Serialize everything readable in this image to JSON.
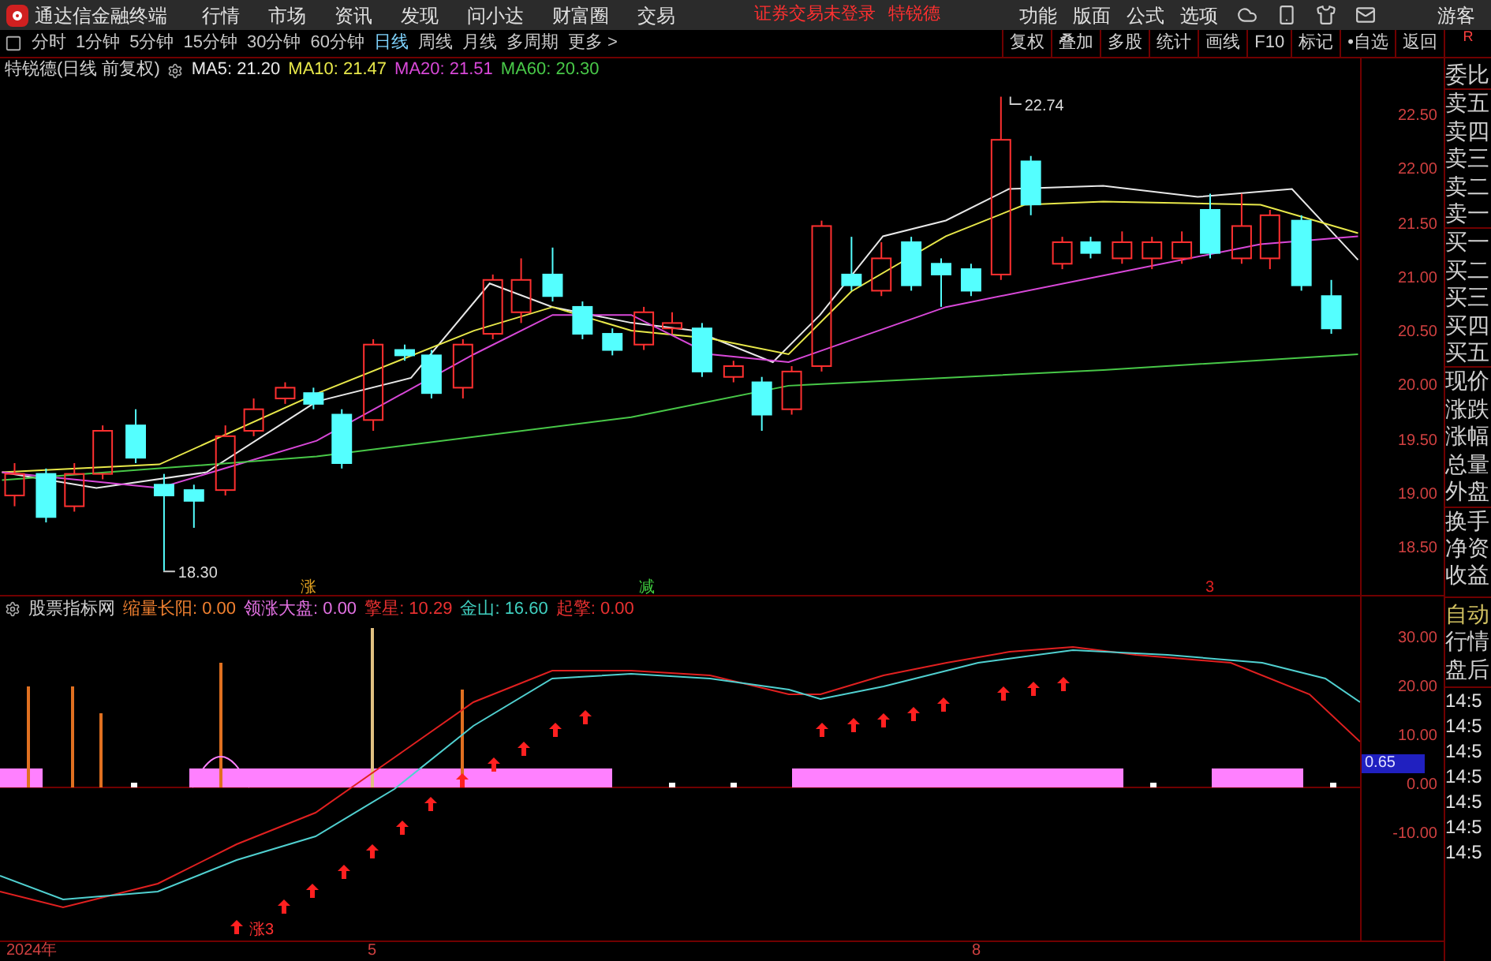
{
  "app": {
    "title": "通达信金融终端"
  },
  "menu": [
    "行情",
    "市场",
    "资讯",
    "发现",
    "问小达",
    "财富圈",
    "交易"
  ],
  "login_status": "证券交易未登录",
  "stock_name": "特锐德",
  "menu_right": [
    "功能",
    "版面",
    "公式",
    "选项"
  ],
  "user": "游客",
  "periods": [
    {
      "label": "分时",
      "selected": false
    },
    {
      "label": "1分钟",
      "selected": false
    },
    {
      "label": "5分钟",
      "selected": false
    },
    {
      "label": "15分钟",
      "selected": false
    },
    {
      "label": "30分钟",
      "selected": false
    },
    {
      "label": "60分钟",
      "selected": false
    },
    {
      "label": "日线",
      "selected": true
    },
    {
      "label": "周线",
      "selected": false
    },
    {
      "label": "月线",
      "selected": false
    },
    {
      "label": "多周期",
      "selected": false
    },
    {
      "label": "更多 >",
      "selected": false
    }
  ],
  "toolbar_buttons": [
    "复权",
    "叠加",
    "多股",
    "统计",
    "画线",
    "F10",
    "标记",
    "•自选",
    "返回"
  ],
  "chart": {
    "title": "特锐德(日线 前复权)",
    "ma": [
      {
        "text": "MA5: 21.20",
        "color": "#e8e8e8"
      },
      {
        "text": "MA10: 21.47",
        "color": "#e8e84a"
      },
      {
        "text": "MA20: 21.51",
        "color": "#d848d8"
      },
      {
        "text": "MA60: 20.30",
        "color": "#48c848"
      }
    ],
    "price_ticks": [
      "22.50",
      "22.00",
      "21.50",
      "21.00",
      "20.50",
      "20.00",
      "19.50",
      "19.00",
      "18.50"
    ],
    "high_label": "22.74",
    "low_label": "18.30",
    "markers": [
      {
        "text": "涨",
        "color": "#e0a020"
      },
      {
        "text": "减",
        "color": "#40d040"
      },
      {
        "text": "3",
        "color": "#e02020"
      }
    ]
  },
  "indicator": {
    "title": "股票指标网",
    "legend": [
      {
        "text": "缩量长阳: 0.00",
        "color": "#f08030"
      },
      {
        "text": "领涨大盘: 0.00",
        "color": "#e070e0"
      },
      {
        "text": "擎星: 10.29",
        "color": "#e83030"
      },
      {
        "text": "金山: 16.60",
        "color": "#40d0c0"
      },
      {
        "text": "起擎: 0.00",
        "color": "#e83030"
      }
    ],
    "ticks": [
      "30.00",
      "20.00",
      "10.00",
      "0.00",
      "-10.00"
    ],
    "current_value": "0.65",
    "signal_label": "涨3"
  },
  "date_axis": [
    "2024年",
    "5",
    "8"
  ],
  "quote_panel": {
    "header": "R",
    "labels": [
      "委比",
      "卖五",
      "卖四",
      "卖三",
      "卖二",
      "卖一",
      "买一",
      "买二",
      "买三",
      "买四",
      "买五",
      "现价",
      "涨跌",
      "涨幅",
      "总量",
      "外盘",
      "换手",
      "净资",
      "收益"
    ],
    "modes": [
      "自动",
      "行情",
      "盘后"
    ],
    "times": [
      "14:5",
      "14:5",
      "14:5",
      "14:5",
      "14:5",
      "14:5",
      "14:5"
    ]
  }
}
